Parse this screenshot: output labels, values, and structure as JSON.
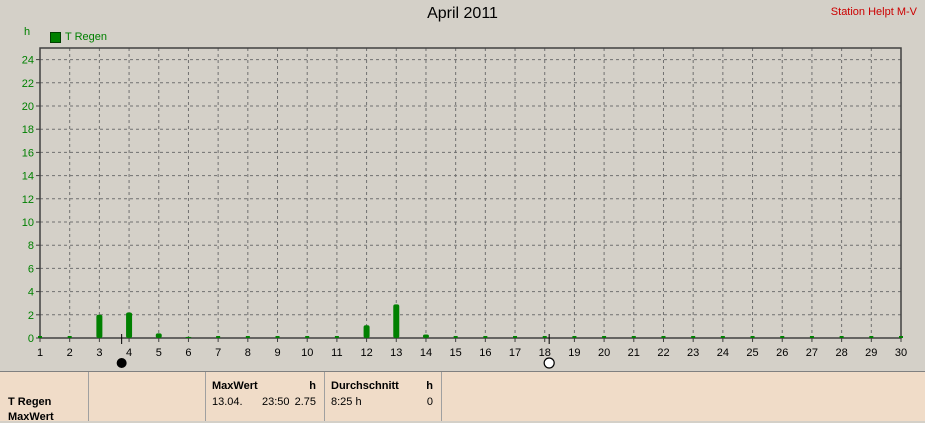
{
  "header": {
    "title": "April 2011",
    "station": "Station Helpt M-V"
  },
  "chart_data": {
    "type": "bar",
    "title": "April 2011",
    "ylabel": "h",
    "legend_position": "top-left",
    "grid": true,
    "ylim": [
      0,
      25
    ],
    "yticks": [
      0,
      2,
      4,
      6,
      8,
      10,
      12,
      14,
      16,
      18,
      20,
      22,
      24
    ],
    "categories": [
      "1",
      "2",
      "3",
      "4",
      "5",
      "6",
      "7",
      "8",
      "9",
      "10",
      "11",
      "12",
      "13",
      "14",
      "15",
      "16",
      "17",
      "18",
      "19",
      "20",
      "21",
      "22",
      "23",
      "24",
      "25",
      "26",
      "27",
      "28",
      "29",
      "30"
    ],
    "series": [
      {
        "name": "T Regen",
        "color": "#008000",
        "values": [
          0,
          0,
          2.0,
          2.2,
          0.4,
          0.1,
          0,
          0,
          0,
          0,
          0,
          1.1,
          2.9,
          0.3,
          0,
          0,
          0,
          0,
          0,
          0,
          0,
          0,
          0,
          0,
          0,
          0,
          0,
          0,
          0,
          0
        ]
      }
    ],
    "markers": [
      {
        "type": "new-moon",
        "x": 3.75
      },
      {
        "type": "full-moon",
        "x": 18.15
      }
    ]
  },
  "stats": {
    "series_label": "T Regen",
    "row2_label": "MaxWert",
    "max_header": "MaxWert",
    "max_unit": "h",
    "max_date": "13.04.",
    "max_time": "23:50",
    "max_value": "2.75",
    "avg_header": "Durchschnitt",
    "avg_unit": "h",
    "avg_value": "8:25 h",
    "avg_extra": "0"
  }
}
